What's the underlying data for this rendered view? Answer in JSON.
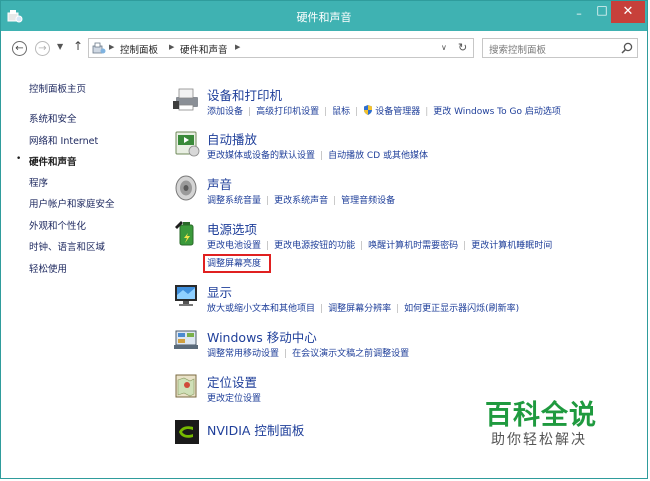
{
  "window": {
    "title": "硬件和声音",
    "minimize_symbol": "–",
    "maximize_symbol": "□",
    "close_symbol": "✕"
  },
  "nav": {
    "back_symbol": "←",
    "forward_symbol": "→",
    "recent_symbol": "▼",
    "up_symbol": "↑",
    "breadcrumb": [
      "控制面板",
      "硬件和声音"
    ],
    "dropdown_symbol": "∨",
    "refresh_symbol": "↻",
    "search_placeholder": "搜索控制面板"
  },
  "sidebar": {
    "items": [
      {
        "label": "控制面板主页"
      },
      {
        "label": "系统和安全"
      },
      {
        "label": "网络和 Internet"
      },
      {
        "label": "硬件和声音",
        "current": true
      },
      {
        "label": "程序"
      },
      {
        "label": "用户帐户和家庭安全"
      },
      {
        "label": "外观和个性化"
      },
      {
        "label": "时钟、语言和区域"
      },
      {
        "label": "轻松使用"
      }
    ],
    "current_marker": "•"
  },
  "categories": [
    {
      "title": "设备和打印机",
      "icon": "printer-icon",
      "links": [
        [
          "添加设备",
          "高级打印机设置",
          "鼠标",
          "设备管理器",
          "更改 Windows To Go 启动选项"
        ]
      ]
    },
    {
      "title": "自动播放",
      "icon": "autoplay-icon",
      "links": [
        [
          "更改媒体或设备的默认设置",
          "自动播放 CD 或其他媒体"
        ]
      ]
    },
    {
      "title": "声音",
      "icon": "speaker-icon",
      "links": [
        [
          "调整系统音量",
          "更改系统声音",
          "管理音频设备"
        ]
      ]
    },
    {
      "title": "电源选项",
      "icon": "battery-icon",
      "links": [
        [
          "更改电池设置",
          "更改电源按钮的功能",
          "唤醒计算机时需要密码",
          "更改计算机睡眠时间"
        ],
        [
          "调整屏幕亮度"
        ]
      ]
    },
    {
      "title": "显示",
      "icon": "display-icon",
      "links": [
        [
          "放大或缩小文本和其他项目",
          "调整屏幕分辨率",
          "如何更正显示器闪烁(刷新率)"
        ]
      ]
    },
    {
      "title": "Windows 移动中心",
      "icon": "mobility-center-icon",
      "links": [
        [
          "调整常用移动设置",
          "在会议演示文稿之前调整设置"
        ]
      ]
    },
    {
      "title": "定位设置",
      "icon": "location-icon",
      "links": [
        [
          "更改定位设置"
        ]
      ]
    },
    {
      "title": "NVIDIA 控制面板",
      "icon": "nvidia-icon",
      "links": []
    }
  ],
  "watermark": {
    "title": "百科全说",
    "subtitle": "助你轻松解决"
  },
  "colors": {
    "titlebar": "#3fb2b2",
    "close": "#c7403a",
    "link": "#1f3f9a",
    "highlight": "#e02020",
    "watermark": "#1f9a3f"
  }
}
